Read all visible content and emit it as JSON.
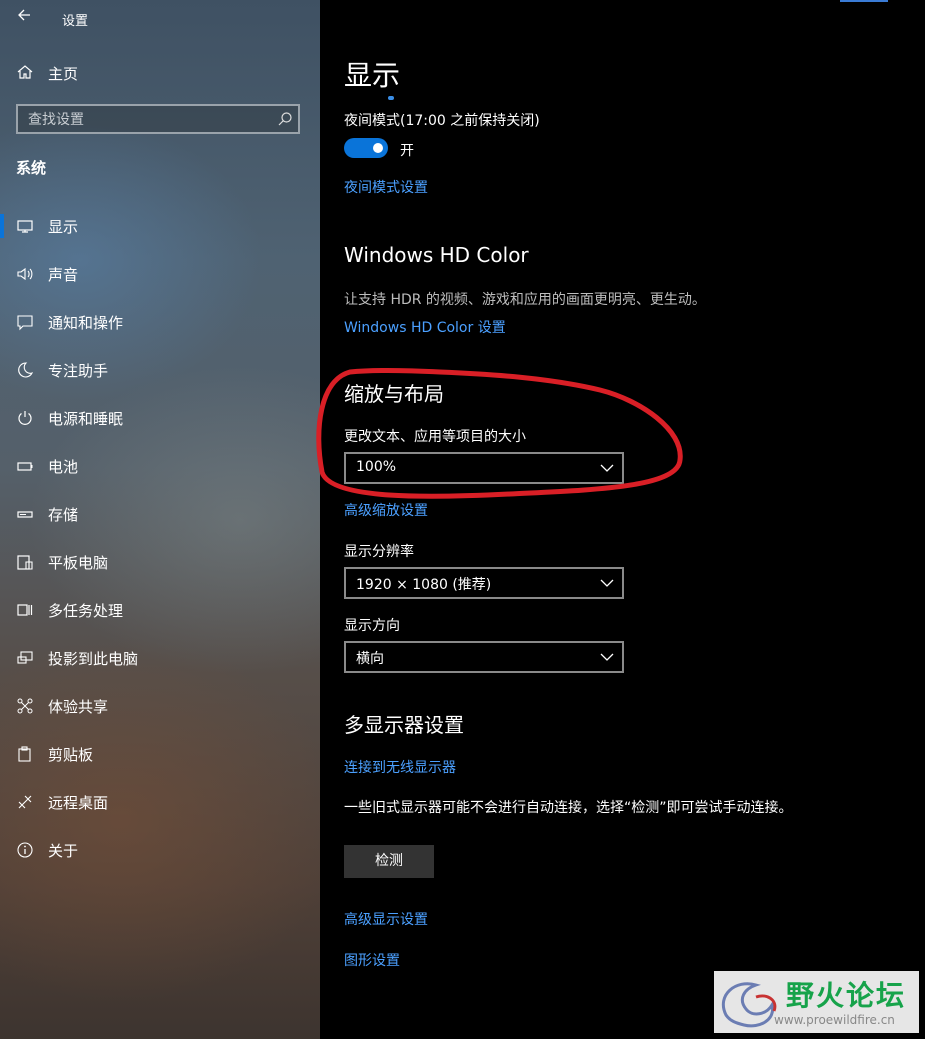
{
  "window": {
    "title": "设置",
    "back_icon": "back-arrow-icon"
  },
  "sidebar": {
    "home_label": "主页",
    "search_placeholder": "查找设置",
    "section_title": "系统",
    "items": [
      {
        "label": "显示",
        "icon": "monitor-icon",
        "active": true
      },
      {
        "label": "声音",
        "icon": "speaker-icon"
      },
      {
        "label": "通知和操作",
        "icon": "notification-icon"
      },
      {
        "label": "专注助手",
        "icon": "moon-icon"
      },
      {
        "label": "电源和睡眠",
        "icon": "power-icon"
      },
      {
        "label": "电池",
        "icon": "battery-icon"
      },
      {
        "label": "存储",
        "icon": "storage-icon"
      },
      {
        "label": "平板电脑",
        "icon": "tablet-icon"
      },
      {
        "label": "多任务处理",
        "icon": "multitask-icon"
      },
      {
        "label": "投影到此电脑",
        "icon": "project-icon"
      },
      {
        "label": "体验共享",
        "icon": "share-icon"
      },
      {
        "label": "剪贴板",
        "icon": "clipboard-icon"
      },
      {
        "label": "远程桌面",
        "icon": "remote-desktop-icon"
      },
      {
        "label": "关于",
        "icon": "info-icon"
      }
    ]
  },
  "main": {
    "page_title": "显示",
    "night_light": {
      "label": "夜间模式(17:00 之前保持关闭)",
      "toggle_state": "开",
      "toggle_on": true,
      "settings_link": "夜间模式设置"
    },
    "hdr": {
      "title": "Windows HD Color",
      "description": "让支持 HDR 的视频、游戏和应用的画面更明亮、更生动。",
      "link": "Windows HD Color 设置"
    },
    "scale_layout": {
      "title": "缩放与布局",
      "scale_label": "更改文本、应用等项目的大小",
      "scale_value": "100%",
      "advanced_scaling_link": "高级缩放设置",
      "resolution_label": "显示分辨率",
      "resolution_value": "1920 × 1080 (推荐)",
      "orientation_label": "显示方向",
      "orientation_value": "横向"
    },
    "multi_display": {
      "title": "多显示器设置",
      "wireless_link": "连接到无线显示器",
      "description": "一些旧式显示器可能不会进行自动连接，选择“检测”即可尝试手动连接。",
      "detect_button": "检测"
    },
    "advanced_display_link": "高级显示设置",
    "graphics_link": "图形设置"
  },
  "watermark": {
    "title": "野火论坛",
    "url": "www.proewildfire.cn"
  },
  "colors": {
    "accent": "#0a74d9",
    "link": "#4ba0ff",
    "annotation": "#d91f26"
  }
}
